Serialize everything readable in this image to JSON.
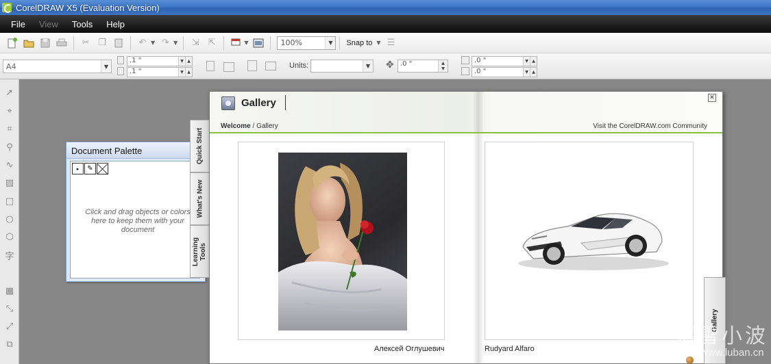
{
  "window": {
    "title": "CorelDRAW X5 (Evaluation Version)"
  },
  "menu": [
    {
      "label": "File",
      "enabled": true
    },
    {
      "label": "View",
      "enabled": false
    },
    {
      "label": "Tools",
      "enabled": true
    },
    {
      "label": "Help",
      "enabled": true
    }
  ],
  "toolbar": {
    "zoom_value": "100%",
    "snap_label": "Snap to"
  },
  "property_bar": {
    "page_size": "A4",
    "width": ".1 \"",
    "height": ".1 \"",
    "units_label": "Units:",
    "nudge": ".0 \"",
    "dup_x": ".0 \"",
    "dup_y": ".0 \""
  },
  "document_palette": {
    "title": "Document Palette",
    "hint": "Click and drag objects or colors here to keep them with your document"
  },
  "welcome_tabs": [
    "Quick Start",
    "What's New",
    "Learning Tools"
  ],
  "welcome": {
    "title": "Gallery",
    "breadcrumb_root": "Welcome",
    "breadcrumb_sep": " / ",
    "breadcrumb_current": "Gallery",
    "community_link": "Visit the CorelDRAW.com Community",
    "cards": [
      {
        "artist": "Алексей Оглушевич"
      },
      {
        "artist": "Rudyard Alfaro"
      }
    ],
    "side_tab": "Gallery"
  },
  "watermark": {
    "text": "落雪小波",
    "url": "www.luban.cn"
  },
  "colors": {
    "accent_green": "#8bbf3f",
    "titlebar_blue": "#3f77c6"
  }
}
